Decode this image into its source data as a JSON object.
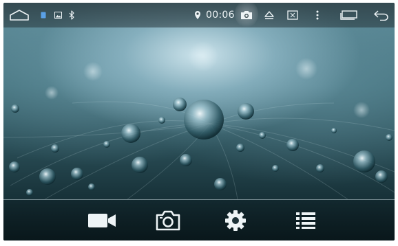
{
  "status_bar": {
    "clock": "00:06",
    "icons": [
      "home-icon",
      "sim-icon",
      "gallery-icon",
      "bluetooth-icon",
      "location-icon",
      "camera-icon",
      "eject-icon",
      "screenshot-icon",
      "more-icon",
      "recent-apps-icon",
      "back-icon"
    ]
  },
  "wallpaper": {
    "subject": "water-droplets-on-feather"
  },
  "bottom_bar": {
    "buttons": [
      "video-camera-icon",
      "camera-icon",
      "settings-icon",
      "list-icon"
    ]
  },
  "colors": {
    "icon": "#eef4f6",
    "status_bar_bg": "#2e3c40",
    "wallpaper_dark": "#0e2126",
    "wallpaper_light": "#cfe3ea"
  }
}
